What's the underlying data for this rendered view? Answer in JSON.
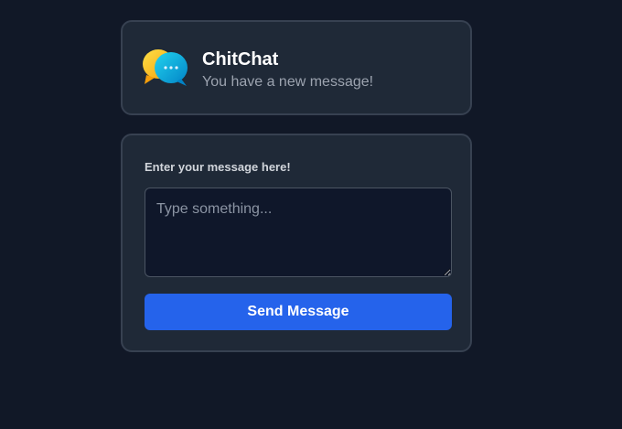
{
  "notification": {
    "app_name": "ChitChat",
    "message": "You have a new message!",
    "icon": "chat-bubbles-icon"
  },
  "form": {
    "label": "Enter your message here!",
    "textarea": {
      "placeholder": "Type something...",
      "value": ""
    },
    "send_button_label": "Send Message"
  },
  "colors": {
    "page_background": "#111827",
    "card_background": "#1f2937",
    "card_border": "#374151",
    "accent_blue": "#2563eb",
    "bubble_yellow": "#facc15",
    "bubble_cyan": "#0ea5e9"
  }
}
